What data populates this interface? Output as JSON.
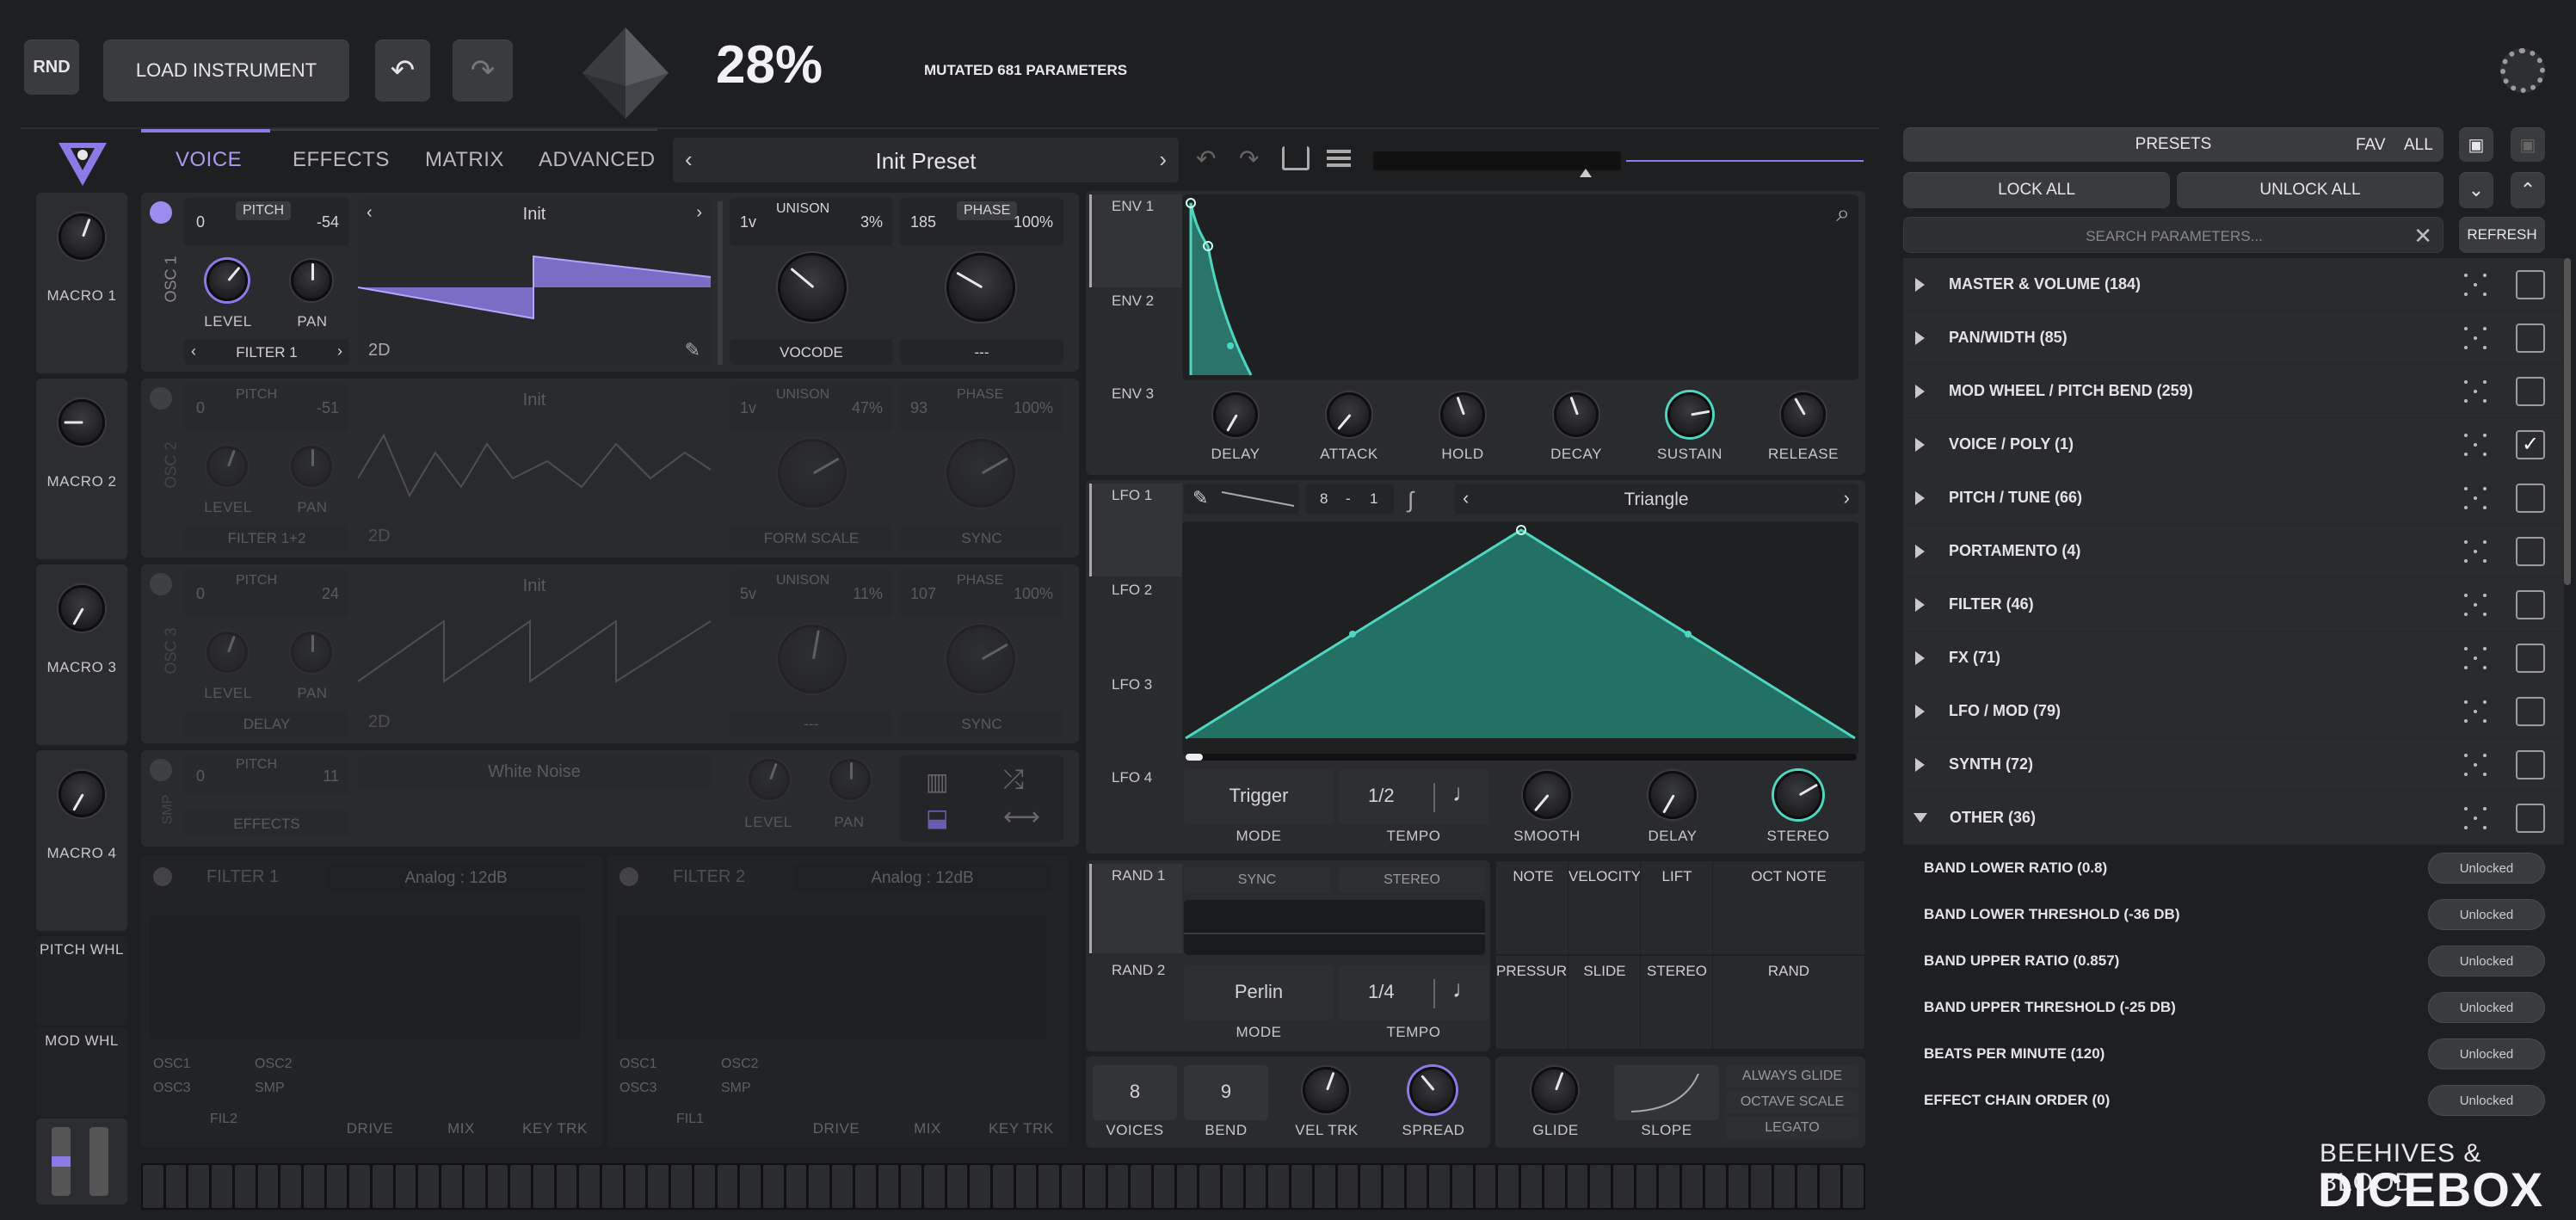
{
  "top": {
    "rnd_label": "RND",
    "load_label": "LOAD INSTRUMENT",
    "percent": "28%",
    "mutated": "MUTATED 681 PARAMETERS"
  },
  "nav": {
    "tabs": [
      "VOICE",
      "EFFECTS",
      "MATRIX",
      "ADVANCED"
    ],
    "preset_name": "Init Preset"
  },
  "macros": [
    "MACRO 1",
    "MACRO 2",
    "MACRO 3",
    "MACRO 4"
  ],
  "wheels": {
    "pitch": "PITCH WHL",
    "mod": "MOD WHL"
  },
  "osc": [
    {
      "label": "OSC 1",
      "pitch_lo": "0",
      "pitch_label": "PITCH",
      "pitch_hi": "-54",
      "wave": "Init",
      "mode": "2D",
      "route": "FILTER 1",
      "unison_v": "1v",
      "unison_label": "UNISON",
      "unison_pct": "3%",
      "phase_v": "185",
      "phase_label": "PHASE",
      "phase_pct": "100%",
      "spectral": "VOCODE",
      "phase_mode": "---"
    },
    {
      "label": "OSC 2",
      "pitch_lo": "0",
      "pitch_label": "PITCH",
      "pitch_hi": "-51",
      "wave": "Init",
      "mode": "2D",
      "route": "FILTER 1+2",
      "unison_v": "1v",
      "unison_label": "UNISON",
      "unison_pct": "47%",
      "phase_v": "93",
      "phase_label": "PHASE",
      "phase_pct": "100%",
      "spectral": "FORM SCALE",
      "phase_mode": "SYNC"
    },
    {
      "label": "OSC 3",
      "pitch_lo": "0",
      "pitch_label": "PITCH",
      "pitch_hi": "24",
      "wave": "Init",
      "mode": "2D",
      "route": "DELAY",
      "unison_v": "5v",
      "unison_label": "UNISON",
      "unison_pct": "11%",
      "phase_v": "107",
      "phase_label": "PHASE",
      "phase_pct": "100%",
      "spectral": "---",
      "phase_mode": "SYNC"
    }
  ],
  "smp": {
    "label": "SMP",
    "pitch_lo": "0",
    "pitch_label": "PITCH",
    "pitch_hi": "11",
    "sample": "White Noise",
    "route": "EFFECTS"
  },
  "knob_labels": {
    "level": "LEVEL",
    "pan": "PAN"
  },
  "filters": [
    {
      "label": "FILTER 1",
      "type": "Analog : 12dB",
      "src": [
        "OSC1",
        "OSC2",
        "OSC3",
        "SMP"
      ],
      "route": "FIL2"
    },
    {
      "label": "FILTER 2",
      "type": "Analog : 12dB",
      "src": [
        "OSC1",
        "OSC2",
        "OSC3",
        "SMP"
      ],
      "route": "FIL1"
    }
  ],
  "filter_knobs": [
    "DRIVE",
    "MIX",
    "KEY TRK"
  ],
  "env": {
    "tabs": [
      "ENV 1",
      "ENV 2",
      "ENV 3"
    ],
    "knobs": [
      "DELAY",
      "ATTACK",
      "HOLD",
      "DECAY",
      "SUSTAIN",
      "RELEASE"
    ]
  },
  "lfo": {
    "tabs": [
      "LFO 1",
      "LFO 2",
      "LFO 3",
      "LFO 4"
    ],
    "grid_a": "8",
    "grid_sep": "-",
    "grid_b": "1",
    "shape": "Triangle",
    "mode_value": "Trigger",
    "mode_label": "MODE",
    "tempo_value": "1/2",
    "tempo_label": "TEMPO",
    "knobs": [
      "SMOOTH",
      "DELAY",
      "STEREO"
    ]
  },
  "rand": {
    "tabs": [
      "RAND 1",
      "RAND 2"
    ],
    "sync": "SYNC",
    "stereo": "STEREO",
    "mode_value": "Perlin",
    "mode_label": "MODE",
    "tempo_value": "1/4",
    "tempo_label": "TEMPO"
  },
  "mod_sources": [
    "NOTE",
    "VELOCITY",
    "LIFT",
    "OCT NOTE",
    "PRESSURE",
    "SLIDE",
    "STEREO",
    "RAND"
  ],
  "voice": {
    "voices_value": "8",
    "voices_label": "VOICES",
    "bend_value": "9",
    "bend_label": "BEND",
    "veltrk": "VEL TRK",
    "spread": "SPREAD",
    "glide": "GLIDE",
    "slope": "SLOPE",
    "always_glide": "ALWAYS GLIDE",
    "octave_scale": "OCTAVE SCALE",
    "legato": "LEGATO"
  },
  "right": {
    "presets": "PRESETS",
    "fav": "FAV",
    "all": "ALL",
    "lock_all": "LOCK ALL",
    "unlock_all": "UNLOCK ALL",
    "search_placeholder": "SEARCH PARAMETERS...",
    "refresh": "REFRESH",
    "groups": [
      {
        "name": "MASTER & VOLUME  (184)",
        "checked": false
      },
      {
        "name": "PAN/WIDTH  (85)",
        "checked": false
      },
      {
        "name": "MOD WHEEL / PITCH BEND  (259)",
        "checked": false
      },
      {
        "name": "VOICE / POLY  (1)",
        "checked": true
      },
      {
        "name": "PITCH / TUNE  (66)",
        "checked": false
      },
      {
        "name": "PORTAMENTO  (4)",
        "checked": false
      },
      {
        "name": "FILTER  (46)",
        "checked": false
      },
      {
        "name": "FX  (71)",
        "checked": false
      },
      {
        "name": "LFO / MOD  (79)",
        "checked": false
      },
      {
        "name": "SYNTH  (72)",
        "checked": false
      },
      {
        "name": "OTHER  (36)",
        "checked": false
      }
    ],
    "other_items": [
      {
        "name": "BAND LOWER RATIO  (0.8)",
        "state": "Unlocked"
      },
      {
        "name": "BAND LOWER THRESHOLD  (-36 DB)",
        "state": "Unlocked"
      },
      {
        "name": "BAND UPPER RATIO  (0.857)",
        "state": "Unlocked"
      },
      {
        "name": "BAND UPPER THRESHOLD  (-25 DB)",
        "state": "Unlocked"
      },
      {
        "name": "BEATS PER MINUTE  (120)",
        "state": "Unlocked"
      },
      {
        "name": "EFFECT CHAIN ORDER  (0)",
        "state": "Unlocked"
      }
    ]
  },
  "brand": {
    "line1": "BEEHIVES & BLOOD",
    "line2": "DICEBOX"
  },
  "colors": {
    "accent": "#8c7ae6",
    "teal": "#4fd6c0",
    "bg": "#1e1f21"
  },
  "icons": {
    "undo": "undo-icon",
    "redo": "redo-icon",
    "settings": "gear-icon",
    "logo": "v-logo-icon",
    "dice": "d20-icon"
  }
}
